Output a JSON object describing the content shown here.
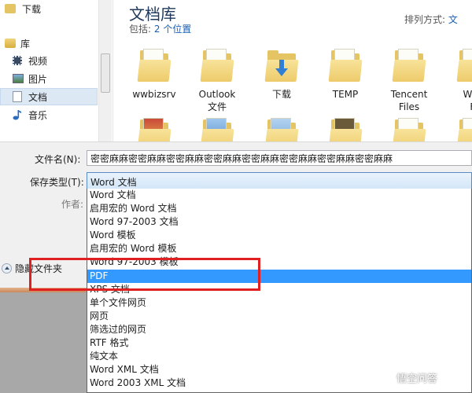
{
  "nav": {
    "items": [
      {
        "label": "下载",
        "icon": "download-folder-icon"
      },
      {
        "label": "库",
        "icon": "library-icon"
      },
      {
        "label": "视频",
        "icon": "video-library-icon"
      },
      {
        "label": "图片",
        "icon": "pictures-library-icon"
      },
      {
        "label": "文档",
        "icon": "documents-library-icon",
        "selected": true
      },
      {
        "label": "音乐",
        "icon": "music-library-icon"
      }
    ]
  },
  "library": {
    "title": "文档库",
    "subtitle_prefix": "包括:",
    "subtitle_link": "2 个位置",
    "arrange_label": "排列方式:",
    "arrange_value": "文",
    "folders": [
      {
        "name": "wwbizsrv"
      },
      {
        "name": "Outlook\n文件"
      },
      {
        "name": "下载"
      },
      {
        "name": "TEMP"
      },
      {
        "name": "Tencent\nFiles"
      },
      {
        "name": "WeC\nFi"
      }
    ]
  },
  "form": {
    "filename_label": "文件名(N):",
    "filename_value": "密密麻麻密密麻麻密密麻麻密密麻麻密密麻麻密密麻麻密密麻麻密密麻麻",
    "type_label": "保存类型(T):",
    "type_value": "Word 文档",
    "author_label": "作者:",
    "hide_folders_label": "隐藏文件夹"
  },
  "dropdown": {
    "options": [
      "Word 文档",
      "启用宏的 Word 文档",
      "Word 97-2003 文档",
      "Word 模板",
      "启用宏的 Word 模板",
      "Word 97-2003 模板",
      "PDF",
      "XPS 文档",
      "单个文件网页",
      "网页",
      "筛选过的网页",
      "RTF 格式",
      "纯文本",
      "Word XML 文档",
      "Word 2003 XML 文档"
    ],
    "highlighted_index": 6
  },
  "watermark": {
    "text": "悟空问答"
  },
  "colors": {
    "highlight": "#3399ff",
    "annotation": "#e02020",
    "folder": "#e5c463"
  }
}
